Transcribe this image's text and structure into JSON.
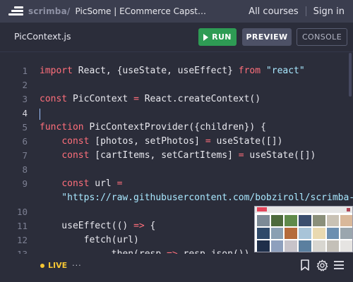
{
  "nav": {
    "brand": "scrimba",
    "brand_slash": "/",
    "course_title": "PicSome | ECommerce Capsto...",
    "all_courses": "All courses",
    "sign_in": "Sign in"
  },
  "file": {
    "name": "PicContext.js",
    "run_label": "RUN",
    "preview_label": "PREVIEW",
    "console_label": "CONSOLE"
  },
  "editor": {
    "active_line": "4",
    "line_numbers": [
      "1",
      "2",
      "3",
      "4",
      "5",
      "6",
      "7",
      "8",
      "9",
      "",
      "10",
      "11",
      "12",
      "13"
    ],
    "lines": [
      "import React, {useState, useEffect} from \"react\"",
      "",
      "const PicContext = React.createContext()",
      "",
      "function PicContextProvider({children}) {",
      "    const [photos, setPhotos] = useState([])",
      "    const [cartItems, setCartItems] = useState([])",
      "",
      "    const url =",
      "    \"https://raw.githubusercontent.com/bobziroll/scrimba-",
      "",
      "    useEffect(() => {",
      "        fetch(url)",
      "            .then(resp => resp.json())"
    ]
  },
  "status": {
    "live_label": "LIVE",
    "more_label": "···"
  },
  "icons": {
    "bookmark": "bookmark-icon",
    "settings": "gear-icon",
    "menu": "menu-icon"
  },
  "colors": {
    "run_green": "#2e9b54",
    "live_yellow": "#f5c634",
    "keyword_pink": "#ff6f7b",
    "string_blue": "#a9e8ff"
  }
}
